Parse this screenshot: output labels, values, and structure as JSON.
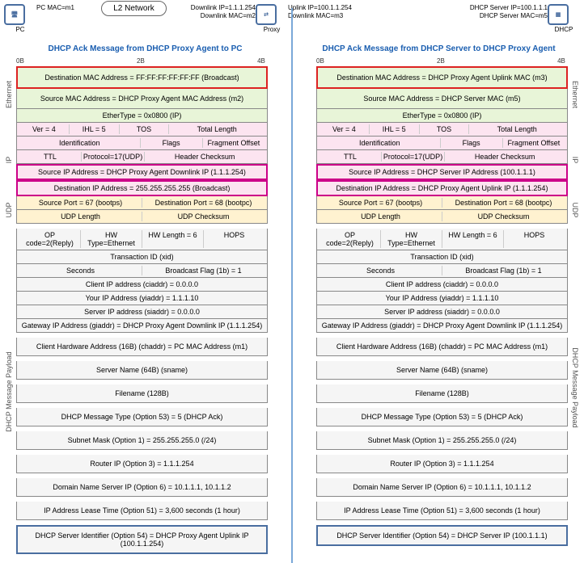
{
  "topology": {
    "pc": {
      "label": "PC",
      "mac": "PC MAC=m1"
    },
    "l2": "L2 Network",
    "proxy": {
      "label": "Proxy",
      "downlink_ip": "Downlink IP=1.1.1.254",
      "downlink_mac": "Downlink MAC=m2",
      "uplink_ip": "Uplink IP=100.1.1.254",
      "uplink_mac": "Downlink MAC=m3"
    },
    "dhcp": {
      "label": "DHCP",
      "server_ip": "DHCP Server IP=100.1.1.1",
      "server_mac": "DHCP Server MAC=m5"
    }
  },
  "left": {
    "title": "DHCP Ack Message from DHCP Proxy Agent to PC",
    "ruler": [
      "0B",
      "2B",
      "4B"
    ],
    "eth": {
      "dstmac": "Destination MAC Address = FF:FF:FF:FF:FF:FF (Broadcast)",
      "srcmac": "Source MAC Address = DHCP Proxy Agent MAC Address (m2)",
      "etype": "EtherType = 0x0800 (IP)",
      "label": "Ethernet"
    },
    "ip": {
      "r1": [
        "Ver = 4",
        "IHL = 5",
        "TOS",
        "Total Length"
      ],
      "r2": [
        "Identification",
        "Flags",
        "Fragment Offset"
      ],
      "r3": [
        "TTL",
        "Protocol=17(UDP)",
        "Header Checksum"
      ],
      "src": "Source IP Address = DHCP Proxy Agent Downlink IP (1.1.1.254)",
      "dst": "Destination IP Address = 255.255.255.255 (Broadcast)",
      "label": "IP"
    },
    "udp": {
      "r1": [
        "Source Port = 67 (bootps)",
        "Destination Port = 68 (bootpc)"
      ],
      "r2": [
        "UDP Length",
        "UDP Checksum"
      ],
      "label": "UDP"
    },
    "pay": {
      "r1": [
        "OP code=2(Reply)",
        "HW Type=Ethernet",
        "HW Length = 6",
        "HOPS"
      ],
      "xid": "Transaction ID (xid)",
      "r3": [
        "Seconds",
        "Broadcast Flag (1b) = 1"
      ],
      "ciaddr": "Client IP address (ciaddr) = 0.0.0.0",
      "yiaddr": "Your IP Address (yiaddr) = 1.1.1.10",
      "siaddr": "Server IP address (siaddr) = 0.0.0.0",
      "giaddr": "Gateway IP Address (giaddr) = DHCP Proxy Agent Downlink IP (1.1.1.254)",
      "chaddr": "Client Hardware Address (16B) (chaddr) = PC MAC Address (m1)",
      "sname": "Server Name (64B) (sname)",
      "fname": "Filename (128B)",
      "opt53": "DHCP Message Type (Option 53) = 5 (DHCP Ack)",
      "opt1": "Subnet Mask (Option 1) = 255.255.255.0 (/24)",
      "opt3": "Router IP (Option 3) = 1.1.1.254",
      "opt6": "Domain Name Server IP (Option 6) = 10.1.1.1, 10.1.1.2",
      "opt51": "IP Address Lease Time (Option 51) = 3,600 seconds (1 hour)",
      "opt54": "DHCP Server Identifier (Option 54) = DHCP Proxy Agent Uplink IP (100.1.1.254)",
      "label": "DHCP Message Payload"
    }
  },
  "right": {
    "title": "DHCP Ack Message from DHCP Server to DHCP Proxy Agent",
    "ruler": [
      "0B",
      "2B",
      "4B"
    ],
    "eth": {
      "dstmac": "Destination MAC Address = DHCP Proxy Agent Uplink MAC (m3)",
      "srcmac": "Source MAC Address = DHCP Server MAC (m5)",
      "etype": "EtherType = 0x0800 (IP)",
      "label": "Ethernet"
    },
    "ip": {
      "r1": [
        "Ver = 4",
        "IHL = 5",
        "TOS",
        "Total Length"
      ],
      "r2": [
        "Identification",
        "Flags",
        "Fragment Offset"
      ],
      "r3": [
        "TTL",
        "Protocol=17(UDP)",
        "Header Checksum"
      ],
      "src": "Source IP Address = DHCP Server IP Address (100.1.1.1)",
      "dst": "Destination IP Address = DHCP Proxy Agent Uplink IP (1.1.1.254)",
      "label": "IP"
    },
    "udp": {
      "r1": [
        "Source Port = 67 (bootps)",
        "Destination Port = 68 (bootpc)"
      ],
      "r2": [
        "UDP Length",
        "UDP Checksum"
      ],
      "label": "UDP"
    },
    "pay": {
      "r1": [
        "OP code=2(Reply)",
        "HW Type=Ethernet",
        "HW Length = 6",
        "HOPS"
      ],
      "xid": "Transaction ID (xid)",
      "r3": [
        "Seconds",
        "Broadcast Flag (1b) = 1"
      ],
      "ciaddr": "Client IP address (ciaddr) = 0.0.0.0",
      "yiaddr": "Your IP Address (yiaddr) = 1.1.1.10",
      "siaddr": "Server IP address (siaddr) = 0.0.0.0",
      "giaddr": "Gateway IP Address (giaddr) = DHCP Proxy Agent Downlink IP (1.1.1.254)",
      "chaddr": "Client Hardware Address (16B) (chaddr) = PC MAC Address (m1)",
      "sname": "Server Name (64B) (sname)",
      "fname": "Filename (128B)",
      "opt53": "DHCP Message Type (Option 53) = 5 (DHCP Ack)",
      "opt1": "Subnet Mask (Option 1) = 255.255.255.0 (/24)",
      "opt3": "Router IP (Option 3) = 1.1.1.254",
      "opt6": "Domain Name Server IP (Option 6) = 10.1.1.1, 10.1.1.2",
      "opt51": "IP Address Lease Time (Option 51) = 3,600 seconds (1 hour)",
      "opt54": "DHCP Server Identifier (Option 54) = DHCP Server IP (100.1.1.1)",
      "label": "DHCP Message Payload"
    }
  }
}
